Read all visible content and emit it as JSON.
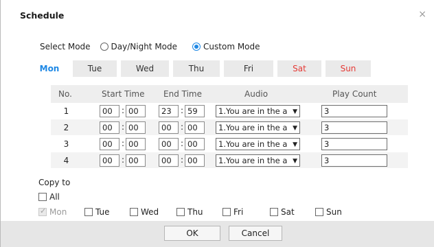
{
  "dialog": {
    "title": "Schedule",
    "close_glyph": "×"
  },
  "mode": {
    "label": "Select Mode",
    "options": [
      {
        "label": "Day/Night Mode",
        "selected": false
      },
      {
        "label": "Custom Mode",
        "selected": true
      }
    ]
  },
  "tabs": [
    "Mon",
    "Tue",
    "Wed",
    "Thu",
    "Fri",
    "Sat",
    "Sun"
  ],
  "active_tab": "Mon",
  "table": {
    "headers": {
      "no": "No.",
      "start": "Start Time",
      "end": "End Time",
      "audio": "Audio",
      "count": "Play Count"
    },
    "rows": [
      {
        "no": "1",
        "start_h": "00",
        "start_m": "00",
        "end_h": "23",
        "end_m": "59",
        "audio": "1.You are in the a",
        "count": "3"
      },
      {
        "no": "2",
        "start_h": "00",
        "start_m": "00",
        "end_h": "00",
        "end_m": "00",
        "audio": "1.You are in the a",
        "count": "3"
      },
      {
        "no": "3",
        "start_h": "00",
        "start_m": "00",
        "end_h": "00",
        "end_m": "00",
        "audio": "1.You are in the a",
        "count": "3"
      },
      {
        "no": "4",
        "start_h": "00",
        "start_m": "00",
        "end_h": "00",
        "end_m": "00",
        "audio": "1.You are in the a",
        "count": "3"
      }
    ]
  },
  "copy": {
    "label": "Copy to",
    "all_label": "All",
    "days": [
      {
        "label": "Mon",
        "checked": true,
        "disabled": true
      },
      {
        "label": "Tue",
        "checked": false,
        "disabled": false
      },
      {
        "label": "Wed",
        "checked": false,
        "disabled": false
      },
      {
        "label": "Thu",
        "checked": false,
        "disabled": false
      },
      {
        "label": "Fri",
        "checked": false,
        "disabled": false
      },
      {
        "label": "Sat",
        "checked": false,
        "disabled": false
      },
      {
        "label": "Sun",
        "checked": false,
        "disabled": false
      }
    ]
  },
  "buttons": {
    "ok": "OK",
    "cancel": "Cancel"
  },
  "colors": {
    "accent": "#1e88e5",
    "weekend": "#e53935",
    "footer": "#e6e6e6"
  }
}
